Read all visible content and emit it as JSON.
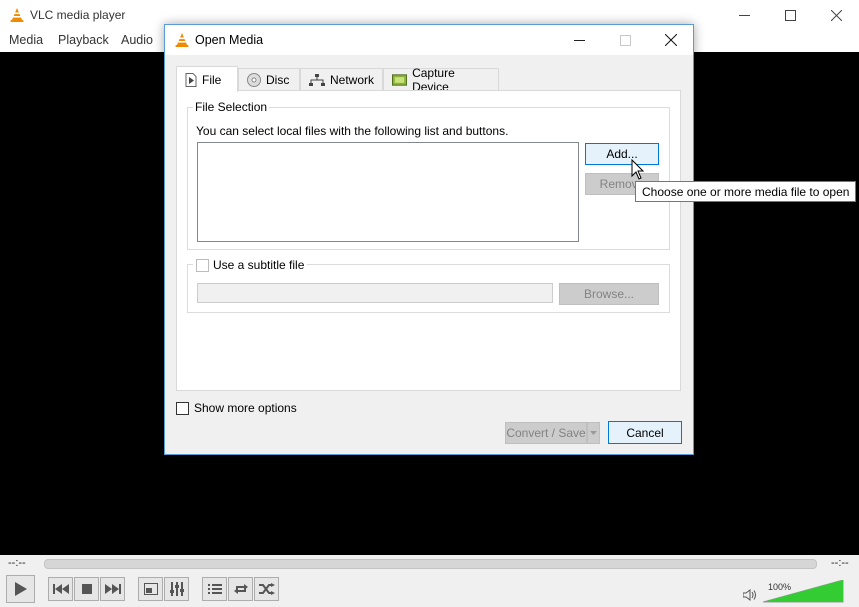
{
  "app": {
    "title": "VLC media player",
    "menu": [
      "Media",
      "Playback",
      "Audio"
    ]
  },
  "player": {
    "time_elapsed": "--:--",
    "time_total": "--:--",
    "volume": "100%",
    "volume_level": 1.0
  },
  "dialog": {
    "title": "Open Media",
    "tabs": [
      {
        "label": "File",
        "icon": "file-icon"
      },
      {
        "label": "Disc",
        "icon": "disc-icon"
      },
      {
        "label": "Network",
        "icon": "network-icon"
      },
      {
        "label": "Capture Device",
        "icon": "capture-device-icon"
      }
    ],
    "file_selection": {
      "legend": "File Selection",
      "description": "You can select local files with the following list and buttons.",
      "add_label": "Add...",
      "remove_label": "Remove"
    },
    "subtitle": {
      "checkbox_label": "Use a subtitle file",
      "browse_label": "Browse..."
    },
    "show_more_label": "Show more options",
    "convert_label": "Convert / Save",
    "cancel_label": "Cancel",
    "tooltip": "Choose one or more media file to open"
  },
  "colors": {
    "accent": "#0078d7",
    "volume_fill": "#33cc33",
    "vlc_orange": "#f08a00"
  }
}
